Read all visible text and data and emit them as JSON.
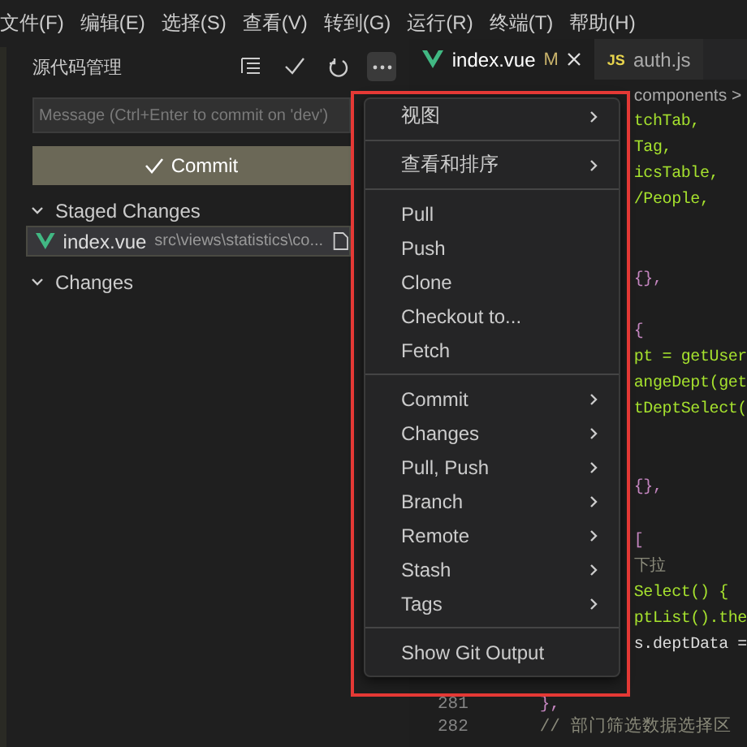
{
  "menu_bar": [
    "文件(F)",
    "编辑(E)",
    "选择(S)",
    "查看(V)",
    "转到(G)",
    "运行(R)",
    "终端(T)",
    "帮助(H)"
  ],
  "sidebar": {
    "title": "源代码管理",
    "message": {
      "placeholder": "Message (Ctrl+Enter to commit on 'dev')"
    },
    "commit_button": "Commit",
    "sections": [
      {
        "label": "Staged Changes",
        "expanded": true,
        "files": [
          {
            "name": "index.vue",
            "path": "src\\views\\statistics\\co...",
            "selected": true
          }
        ]
      },
      {
        "label": "Changes",
        "expanded": true
      }
    ]
  },
  "tabs": [
    {
      "label": "index.vue",
      "badge": "M",
      "selected": true,
      "kind": "vue"
    },
    {
      "label": "auth.js",
      "selected": false,
      "kind": "js",
      "icon_text": "JS"
    }
  ],
  "breadcrumb": "components >",
  "code_lines": [
    {
      "text": "tchTab,",
      "kind": "identifier"
    },
    {
      "text": "Tag,",
      "kind": "identifier"
    },
    {
      "text": "icsTable,",
      "kind": "identifier"
    },
    {
      "text": "/People,",
      "kind": "identifier"
    },
    {
      "kind": "blank"
    },
    {
      "kind": "blank"
    },
    {
      "text": "{},",
      "kind": "brace"
    },
    {
      "kind": "blank"
    },
    {
      "text": "{",
      "kind": "brace"
    },
    {
      "text": "pt = getUser",
      "kind": "call"
    },
    {
      "text": "angeDept(get",
      "kind": "call"
    },
    {
      "text": "tDeptSelect(",
      "kind": "call"
    },
    {
      "kind": "blank"
    },
    {
      "kind": "blank"
    },
    {
      "text": "{},",
      "kind": "brace"
    },
    {
      "kind": "blank"
    },
    {
      "text": "[",
      "kind": "brace"
    },
    {
      "text": "下拉",
      "kind": "comment"
    },
    {
      "text": "Select() {",
      "kind": "call"
    },
    {
      "text": "ptList().the",
      "kind": "call"
    },
    {
      "text": "s.deptData =",
      "kind": "plain"
    }
  ],
  "bottom_lines": [
    {
      "number": "281",
      "text": "},",
      "kind": "brace"
    },
    {
      "number": "282",
      "text": "// 部门筛选数据选择区",
      "kind": "comment"
    }
  ],
  "context_menu": {
    "highlighted": true,
    "groups": [
      [
        {
          "label": "视图",
          "kind": "submenu"
        }
      ],
      [
        {
          "label": "查看和排序",
          "kind": "submenu"
        }
      ],
      [
        {
          "label": "Pull",
          "kind": "action"
        },
        {
          "label": "Push",
          "kind": "action"
        },
        {
          "label": "Clone",
          "kind": "action"
        },
        {
          "label": "Checkout to...",
          "kind": "action"
        },
        {
          "label": "Fetch",
          "kind": "action"
        }
      ],
      [
        {
          "label": "Commit",
          "kind": "submenu"
        },
        {
          "label": "Changes",
          "kind": "submenu"
        },
        {
          "label": "Pull, Push",
          "kind": "submenu"
        },
        {
          "label": "Branch",
          "kind": "submenu"
        },
        {
          "label": "Remote",
          "kind": "submenu"
        },
        {
          "label": "Stash",
          "kind": "submenu"
        },
        {
          "label": "Tags",
          "kind": "submenu"
        }
      ],
      [
        {
          "label": "Show Git Output",
          "kind": "action"
        }
      ]
    ]
  }
}
